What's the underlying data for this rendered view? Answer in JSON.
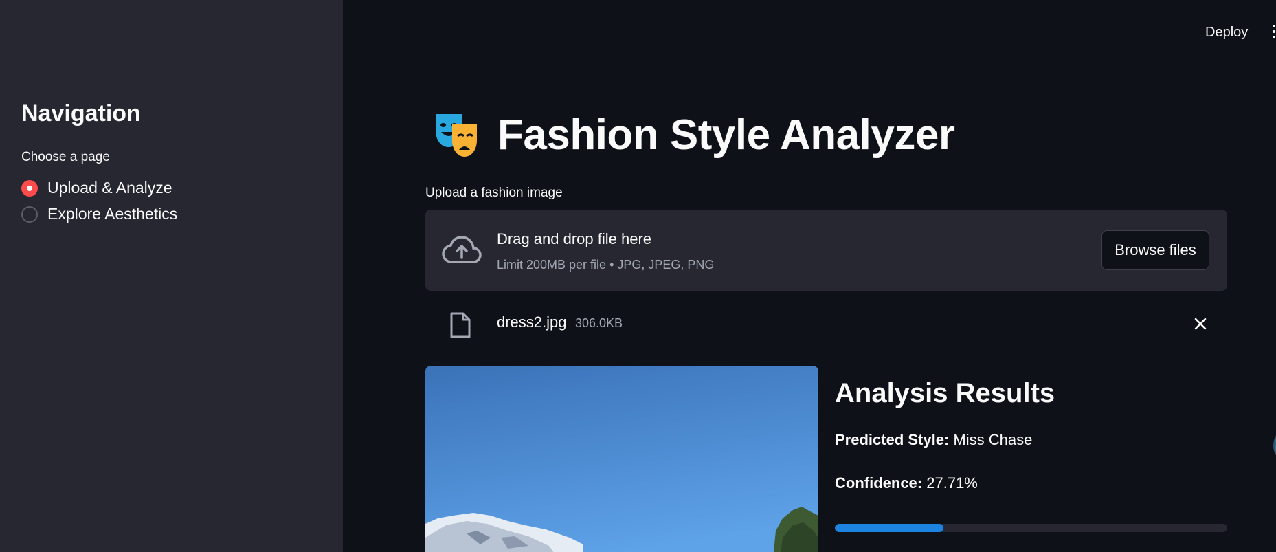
{
  "header": {
    "deploy_label": "Deploy",
    "menu_icon": "kebab-menu-icon"
  },
  "sidebar": {
    "title": "Navigation",
    "choose_label": "Choose a page",
    "options": [
      {
        "label": "Upload & Analyze",
        "selected": true
      },
      {
        "label": "Explore Aesthetics",
        "selected": false
      }
    ]
  },
  "main": {
    "title_icon": "performing-arts-masks-icon",
    "title": "Fashion Style Analyzer",
    "upload_label": "Upload a fashion image",
    "dropzone": {
      "icon": "cloud-upload-icon",
      "title": "Drag and drop file here",
      "limit": "Limit 200MB per file • JPG, JPEG, PNG",
      "browse_label": "Browse files"
    },
    "file": {
      "icon": "file-icon",
      "name": "dress2.jpg",
      "size": "306.0KB",
      "remove_icon": "close-icon"
    },
    "results": {
      "heading": "Analysis Results",
      "predicted_label": "Predicted Style:",
      "predicted_value": "Miss Chase",
      "confidence_label": "Confidence:",
      "confidence_value": "27.71%",
      "confidence_fraction": 0.2771,
      "progress_color": "#1c83e1"
    }
  },
  "colors": {
    "background": "#0e1117",
    "sidebar": "#262730",
    "accent": "#ff4b4b"
  }
}
